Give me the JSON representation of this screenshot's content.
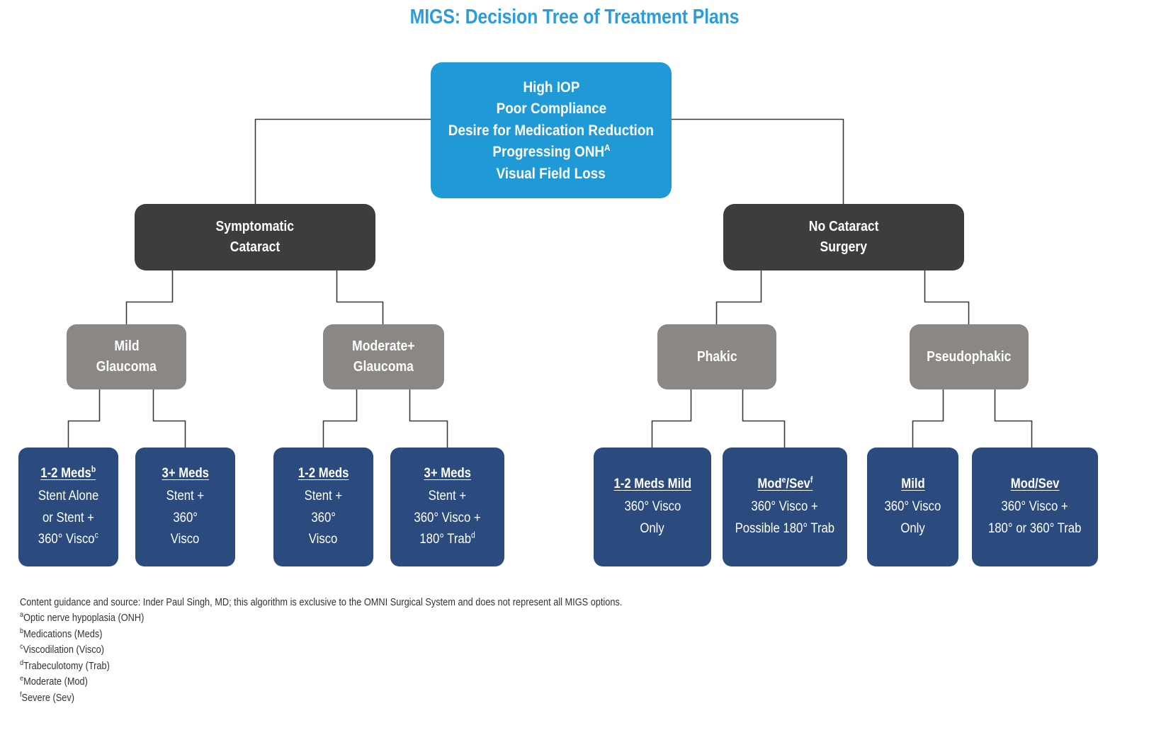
{
  "title": "MIGS: Decision Tree of Treatment Plans",
  "colors": {
    "title": "#2e9cd6",
    "root": "#1f9ad6",
    "branch_dark": "#3d3d3d",
    "branch_grey": "#8a8785",
    "leaf": "#2b4a7d",
    "connector": "#3a3a3a",
    "background": "#ffffff",
    "note_text": "#333333"
  },
  "root": {
    "lines": [
      "High IOP",
      "Poor Compliance",
      "Desire for Medication Reduction",
      "Progressing ONH",
      "Visual Field Loss"
    ],
    "onh_superscript": "A"
  },
  "branches": [
    {
      "id": "symptomatic-cataract",
      "lines": [
        "Symptomatic",
        "Cataract"
      ]
    },
    {
      "id": "no-cataract-surgery",
      "lines": [
        "No Cataract",
        "Surgery"
      ]
    }
  ],
  "subbranches": [
    {
      "id": "mild-glaucoma",
      "lines": [
        "Mild",
        "Glaucoma"
      ]
    },
    {
      "id": "moderate-plus-glaucoma",
      "lines": [
        "Moderate+",
        "Glaucoma"
      ]
    },
    {
      "id": "phakic",
      "lines": [
        "Phakic"
      ]
    },
    {
      "id": "pseudophakic",
      "lines": [
        "Pseudophakic"
      ]
    }
  ],
  "leaves": [
    {
      "id": "mild-1-2-meds",
      "header": "1-2 Meds",
      "header_superscript": "b",
      "lines": [
        "Stent Alone",
        "or Stent +",
        "360° Visco"
      ],
      "last_line_superscript": "c"
    },
    {
      "id": "mild-3-plus-meds",
      "header": "3+ Meds",
      "header_superscript": "",
      "lines": [
        "Stent +",
        "360°",
        "Visco"
      ],
      "last_line_superscript": ""
    },
    {
      "id": "moderate-1-2-meds",
      "header": "1-2 Meds",
      "header_superscript": "",
      "lines": [
        "Stent +",
        "360°",
        "Visco"
      ],
      "last_line_superscript": ""
    },
    {
      "id": "moderate-3-plus-meds",
      "header": "3+ Meds",
      "header_superscript": "",
      "lines": [
        "Stent +",
        "360° Visco +",
        "180° Trab"
      ],
      "last_line_superscript": "d"
    },
    {
      "id": "phakic-1-2-meds-mild",
      "header": "1-2 Meds Mild",
      "header_superscript": "",
      "lines": [
        "360° Visco",
        "Only"
      ],
      "last_line_superscript": ""
    },
    {
      "id": "phakic-mod-sev",
      "header": "Mod",
      "header_superscript": "e",
      "header_tail": "/Sev",
      "header_tail_superscript": "f",
      "lines": [
        "360° Visco +",
        "Possible 180° Trab"
      ],
      "last_line_superscript": ""
    },
    {
      "id": "pseudophakic-mild",
      "header": "Mild",
      "header_superscript": "",
      "lines": [
        "360° Visco",
        "Only"
      ],
      "last_line_superscript": ""
    },
    {
      "id": "pseudophakic-mod-sev",
      "header": "Mod/Sev",
      "header_superscript": "",
      "lines": [
        "360° Visco +",
        "180° or 360° Trab"
      ],
      "last_line_superscript": ""
    }
  ],
  "footnotes": {
    "source": "Content guidance and source: Inder Paul Singh, MD; this algorithm is exclusive to the OMNI Surgical System and does not represent all MIGS options.",
    "items": [
      {
        "marker": "a",
        "text": "Optic nerve hypoplasia (ONH)"
      },
      {
        "marker": "b",
        "text": "Medications (Meds)"
      },
      {
        "marker": "c",
        "text": "Viscodilation (Visco)"
      },
      {
        "marker": "d",
        "text": "Trabeculotomy (Trab)"
      },
      {
        "marker": "e",
        "text": "Moderate (Mod)"
      },
      {
        "marker": "f",
        "text": "Severe (Sev)"
      }
    ]
  }
}
